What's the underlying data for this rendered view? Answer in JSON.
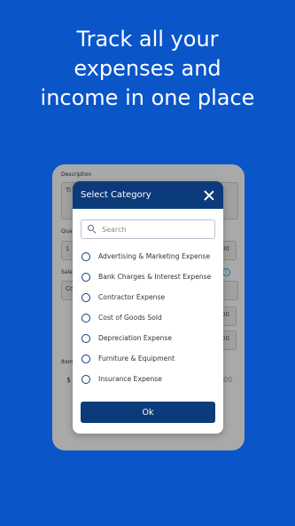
{
  "headline": {
    "line1": "Track all your",
    "line2": "expenses and",
    "line3": "income in one place"
  },
  "background_form": {
    "description_label": "Description",
    "description_value": "Ti",
    "quantity_label": "Qua",
    "quantity_value": "1",
    "sales_label": "Sale",
    "sales_value": "Co",
    "items_label": "Item",
    "currency_symbol": "$",
    "amount_1": "00",
    "amount_2": "00",
    "amount_3": "00",
    "amount_4": "00",
    "info_icon": "i"
  },
  "modal": {
    "title": "Select Category",
    "close_icon": "close-icon",
    "search_placeholder": "Search",
    "options": [
      {
        "label": "Advertising & Marketing Expense"
      },
      {
        "label": "Bank Charges & Interest Expense"
      },
      {
        "label": "Contractor Expense"
      },
      {
        "label": "Cost of Goods Sold"
      },
      {
        "label": "Depreciation Expense"
      },
      {
        "label": "Furniture & Equipment"
      },
      {
        "label": "Insurance Expense"
      }
    ],
    "ok_label": "Ok"
  },
  "colors": {
    "background": "#0a56c9",
    "header": "#0b3b7a",
    "overlay": "#a9a9a9"
  }
}
